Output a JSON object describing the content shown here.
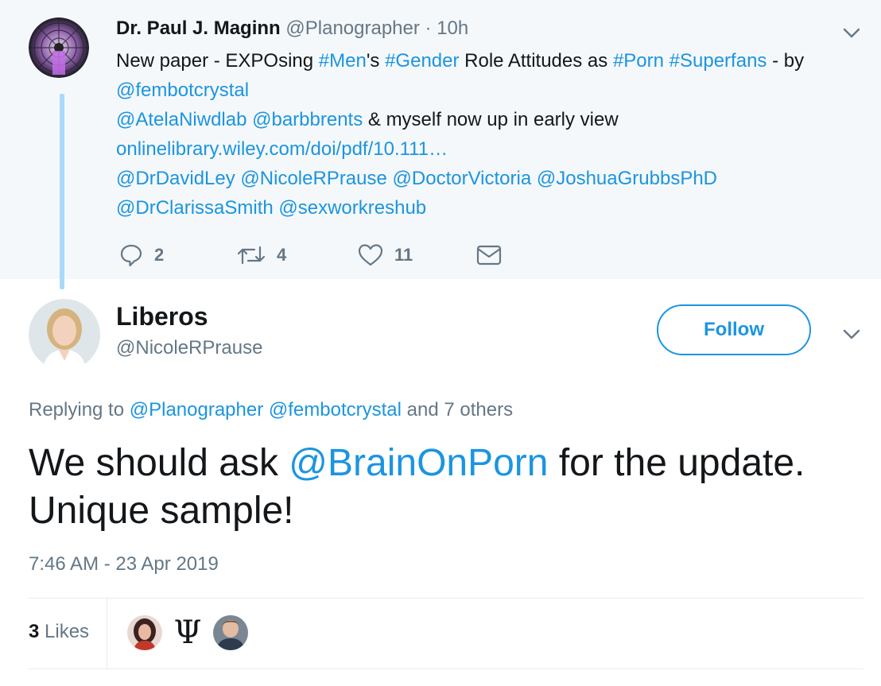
{
  "parent_tweet": {
    "name": "Dr. Paul J. Maginn",
    "handle": "@Planographer",
    "dot": "·",
    "time": "10h",
    "lines": [
      [
        {
          "t": "New paper - EXPOsing "
        },
        {
          "t": "#Men",
          "link": true
        },
        {
          "t": "'s "
        },
        {
          "t": "#Gender",
          "link": true
        },
        {
          "t": " Role Attitudes as "
        },
        {
          "t": "#Porn",
          "link": true
        },
        {
          "t": " "
        },
        {
          "t": "#Superfans",
          "link": true
        },
        {
          "t": " - by"
        }
      ],
      [
        {
          "t": "@fembotcrystal",
          "link": true
        }
      ],
      [
        {
          "t": "@AtelaNiwdlab",
          "link": true
        },
        {
          "t": " "
        },
        {
          "t": "@barbbrents",
          "link": true
        },
        {
          "t": " & myself now up in early view"
        }
      ],
      [
        {
          "t": "onlinelibrary.wiley.com/doi/pdf/10.111…",
          "link": true
        }
      ],
      [
        {
          "t": "@DrDavidLey",
          "link": true
        },
        {
          "t": " "
        },
        {
          "t": "@NicoleRPrause",
          "link": true
        },
        {
          "t": " "
        },
        {
          "t": "@DoctorVictoria",
          "link": true
        },
        {
          "t": " "
        },
        {
          "t": "@JoshuaGrubbsPhD",
          "link": true
        }
      ],
      [
        {
          "t": "@DrClarissaSmith",
          "link": true
        },
        {
          "t": " "
        },
        {
          "t": "@sexworkreshub",
          "link": true
        }
      ]
    ],
    "actions": {
      "reply_count": "2",
      "retweet_count": "4",
      "like_count": "11"
    }
  },
  "reply_tweet": {
    "name": "Liberos",
    "handle": "@NicoleRPrause",
    "follow_label": "Follow",
    "replying_prefix": "Replying to ",
    "replying_to_1": "@Planographer",
    "replying_to_2": "@fembotcrystal",
    "replying_suffix": " and 7 others",
    "text_before": "We should ask ",
    "text_mention": "@BrainOnPorn",
    "text_after": " for the update. Unique sample!",
    "timestamp": "7:46 AM - 23 Apr 2019",
    "likes_count": "3",
    "likes_label": "Likes",
    "liker_2_glyph": "Ψ"
  },
  "colors": {
    "link": "#1b95e0",
    "parent_bg": "#f5f8fa",
    "thread_line": "#a9daf9",
    "secondary_text": "#657786"
  }
}
